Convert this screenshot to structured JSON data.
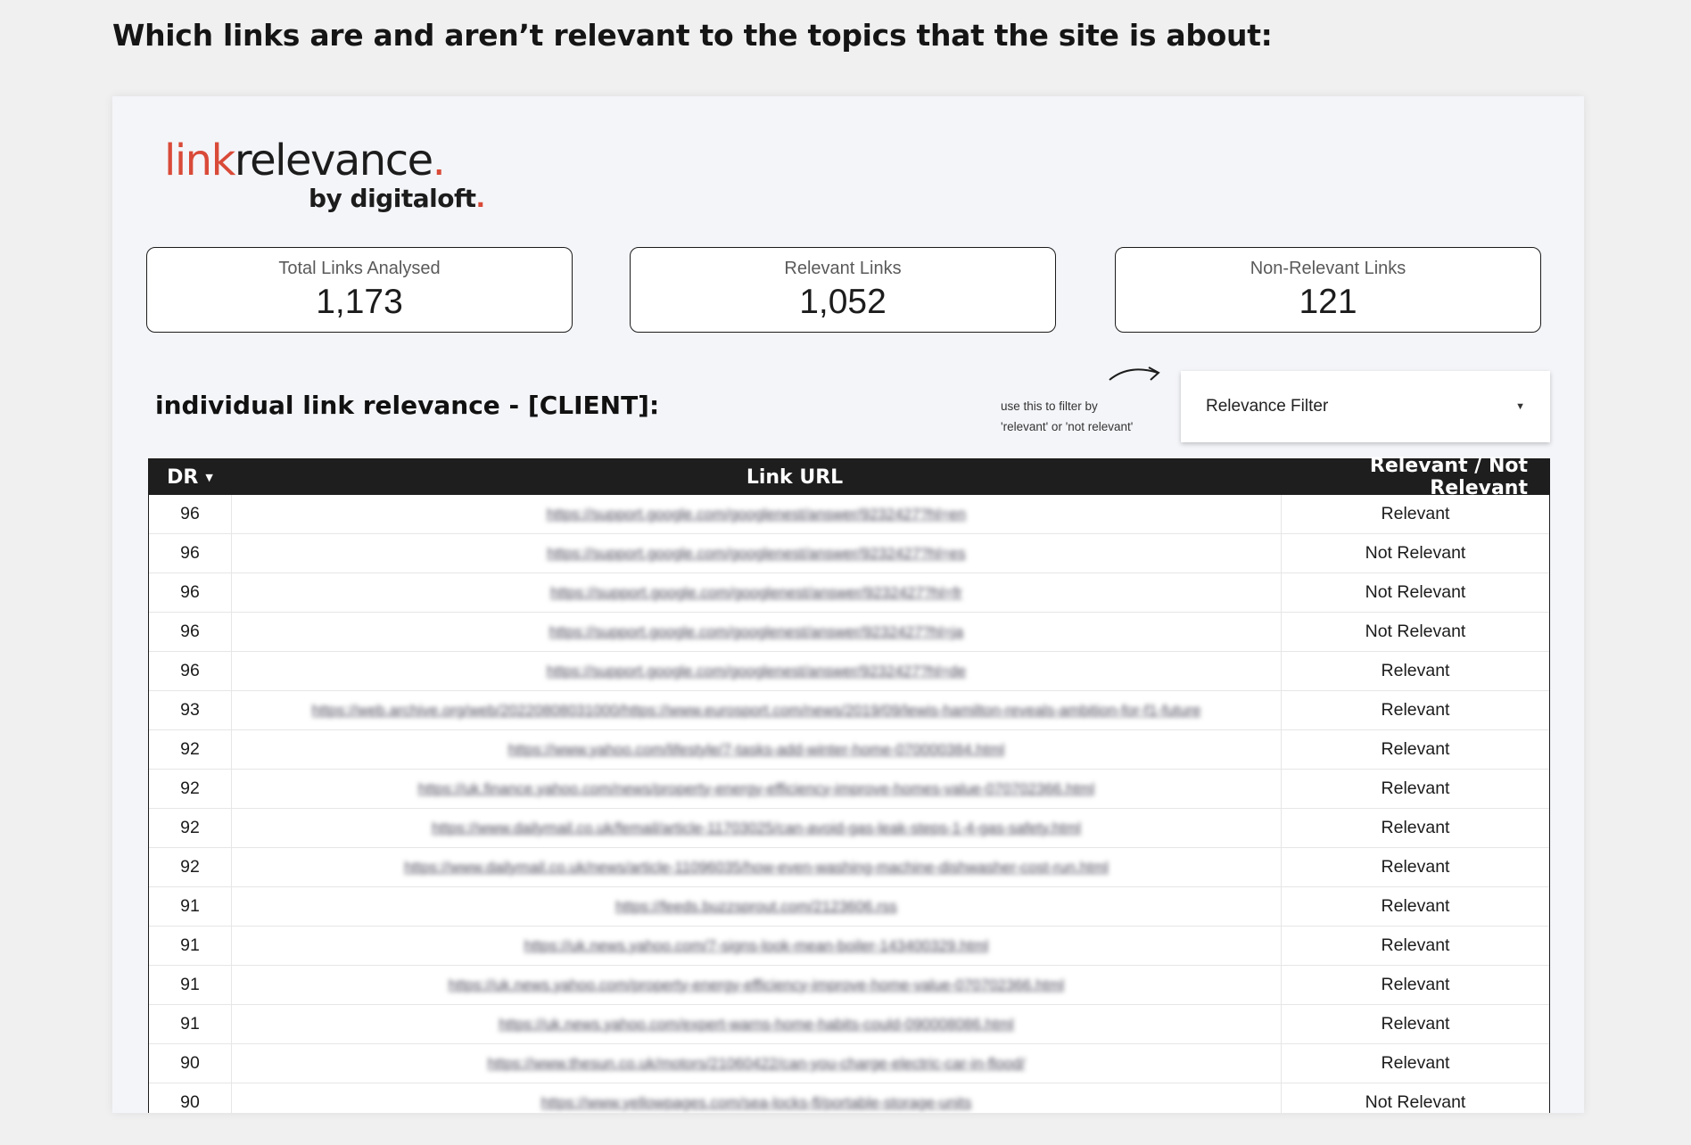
{
  "page": {
    "heading": "Which links are and aren’t relevant to the topics that the site is about:"
  },
  "logo": {
    "part_link": "link",
    "part_relevance": "relevance",
    "dot": ".",
    "sub": "by digitaloft",
    "accent_color": "#d94a38"
  },
  "stats": [
    {
      "label": "Total Links Analysed",
      "value": "1,173"
    },
    {
      "label": "Relevant Links",
      "value": "1,052"
    },
    {
      "label": "Non-Relevant Links",
      "value": "121"
    }
  ],
  "section": {
    "title": "individual link relevance - [CLIENT]:",
    "hint_line1": "use this to filter by",
    "hint_line2": "'relevant' or 'not relevant'"
  },
  "filter": {
    "label": "Relevance Filter",
    "caret_icon": "caret-down-icon"
  },
  "table": {
    "headers": {
      "dr": "DR",
      "url": "Link URL",
      "relevance": "Relevant / Not Relevant"
    },
    "sort_icon": "sort-desc-icon",
    "header_bg": "#1e1e1e",
    "rows": [
      {
        "dr": "96",
        "url": "https://support.google.com/googlenest/answer/9232427?hl=en",
        "relevance": "Relevant"
      },
      {
        "dr": "96",
        "url": "https://support.google.com/googlenest/answer/9232427?hl=es",
        "relevance": "Not Relevant"
      },
      {
        "dr": "96",
        "url": "https://support.google.com/googlenest/answer/9232427?hl=fr",
        "relevance": "Not Relevant"
      },
      {
        "dr": "96",
        "url": "https://support.google.com/googlenest/answer/9232427?hl=ja",
        "relevance": "Not Relevant"
      },
      {
        "dr": "96",
        "url": "https://support.google.com/googlenest/answer/9232427?hl=de",
        "relevance": "Relevant"
      },
      {
        "dr": "93",
        "url": "https://web.archive.org/web/20220808031000/https://www.eurosport.com/news/2019/09/lewis-hamilton-reveals-ambition-for-f1-future",
        "relevance": "Relevant"
      },
      {
        "dr": "92",
        "url": "https://www.yahoo.com/lifestyle/7-tasks-add-winter-home-070000384.html",
        "relevance": "Relevant"
      },
      {
        "dr": "92",
        "url": "https://uk.finance.yahoo.com/news/property-energy-efficiency-improve-homes-value-070702366.html",
        "relevance": "Relevant"
      },
      {
        "dr": "92",
        "url": "https://www.dailymail.co.uk/femail/article-11703025/can-avoid-gas-leak-steps-1-4-gas-safety.html",
        "relevance": "Relevant"
      },
      {
        "dr": "92",
        "url": "https://www.dailymail.co.uk/news/article-11096035/how-even-washing-machine-dishwasher-cost-run.html",
        "relevance": "Relevant"
      },
      {
        "dr": "91",
        "url": "https://feeds.buzzsprout.com/2123606.rss",
        "relevance": "Relevant"
      },
      {
        "dr": "91",
        "url": "https://uk.news.yahoo.com/7-signs-look-mean-boiler-143400329.html",
        "relevance": "Relevant"
      },
      {
        "dr": "91",
        "url": "https://uk.news.yahoo.com/property-energy-efficiency-improve-home-value-070702366.html",
        "relevance": "Relevant"
      },
      {
        "dr": "91",
        "url": "https://uk.news.yahoo.com/expert-warns-home-habits-could-090008086.html",
        "relevance": "Relevant"
      },
      {
        "dr": "90",
        "url": "https://www.thesun.co.uk/motors/21060422/can-you-charge-electric-car-in-flood/",
        "relevance": "Relevant"
      },
      {
        "dr": "90",
        "url": "https://www.yellowpages.com/sea-locks-fl/portable-storage-units",
        "relevance": "Not Relevant"
      }
    ]
  }
}
